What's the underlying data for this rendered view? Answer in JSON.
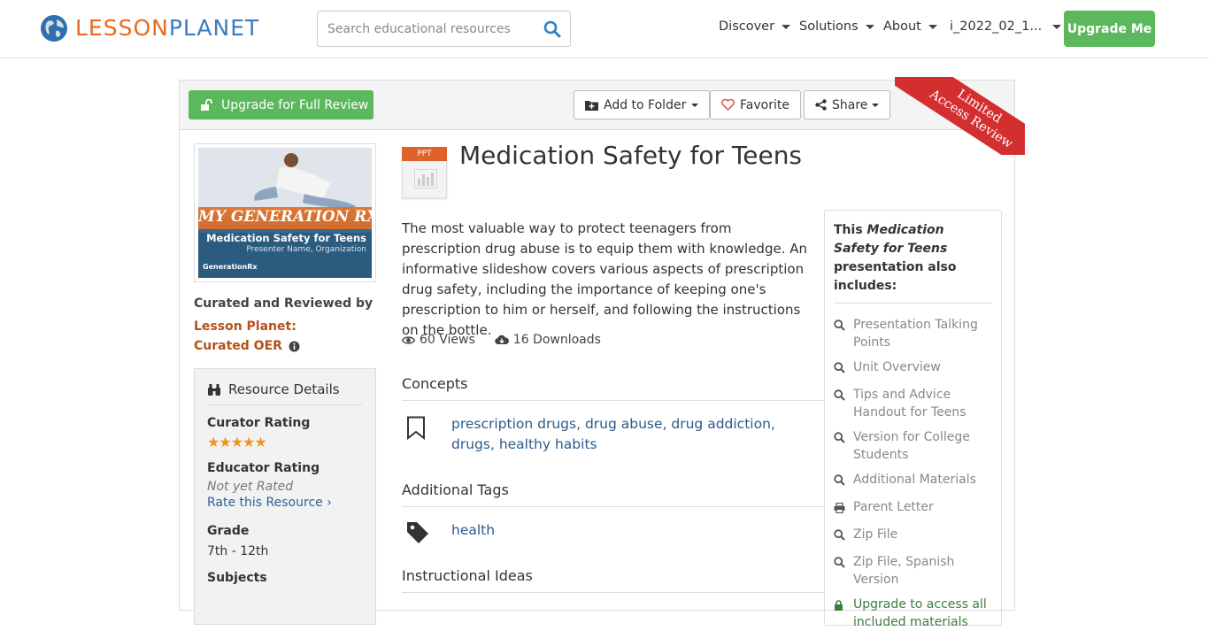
{
  "header": {
    "logo_part1": "LESSON",
    "logo_part2": "PLANET",
    "search_placeholder": "Search educational resources",
    "nav": [
      "Discover",
      "Solutions",
      "About",
      "i_2022_02_1..."
    ],
    "upgrade_label": "Upgrade Me"
  },
  "toolbar": {
    "upgrade_full_label": "Upgrade for Full Review",
    "add_folder_label": "Add to Folder",
    "favorite_label": "Favorite",
    "share_label": "Share",
    "ribbon_line1": "Limited",
    "ribbon_line2": "Access Review"
  },
  "thumbnail": {
    "title_big": "MY GENERATION RX",
    "subtitle": "Medication Safety for Teens",
    "presenter": "Presenter Name, Organization",
    "brand": "GenerationRx"
  },
  "curation": {
    "label": "Curated and Reviewed by",
    "curator_line1": "Lesson Planet:",
    "curator_line2": "Curated OER"
  },
  "details": {
    "heading": "Resource Details",
    "curator_rating_label": "Curator Rating",
    "stars": "★★★★★",
    "educator_rating_label": "Educator Rating",
    "not_rated": "Not yet Rated",
    "rate_link": "Rate this Resource ›",
    "grade_label": "Grade",
    "grade_value": "7th - 12th",
    "subjects_label": "Subjects"
  },
  "resource": {
    "badge": "PPT",
    "title": "Medication Safety for Teens",
    "description": "The most valuable way to protect teenagers from prescription drug abuse is to equip them with knowledge. An informative slideshow covers various aspects of prescription drug safety, including the importance of keeping one's prescription to him or herself, and following the instructions on the bottle.",
    "views": "60 Views",
    "downloads": "16 Downloads"
  },
  "sections": {
    "concepts_title": "Concepts",
    "concepts": [
      "prescription drugs",
      "drug abuse",
      "drug addiction",
      "drugs",
      "healthy habits"
    ],
    "tags_title": "Additional Tags",
    "tags": [
      "health"
    ],
    "ideas_title": "Instructional Ideas"
  },
  "includes": {
    "head_pre": "This ",
    "head_title": "Medication Safety for Teens",
    "head_post": " presentation also includes:",
    "items": [
      {
        "label": "Presentation Talking Points",
        "icon": "search-icon"
      },
      {
        "label": "Unit Overview",
        "icon": "search-icon"
      },
      {
        "label": "Tips and Advice Handout for Teens",
        "icon": "search-icon"
      },
      {
        "label": "Version for College Students",
        "icon": "search-icon"
      },
      {
        "label": "Additional Materials",
        "icon": "search-icon"
      },
      {
        "label": "Parent Letter",
        "icon": "print-icon"
      },
      {
        "label": "Zip File",
        "icon": "search-icon"
      },
      {
        "label": "Zip File, Spanish Version",
        "icon": "search-icon"
      },
      {
        "label": "Upgrade to access all included materials",
        "icon": "lock-icon"
      }
    ]
  },
  "colors": {
    "green": "#5cb85c",
    "ribbon_red": "#d32f2f",
    "link_blue": "#2a5a8a",
    "curator_orange": "#b5501a",
    "star_orange": "#f0941d"
  }
}
